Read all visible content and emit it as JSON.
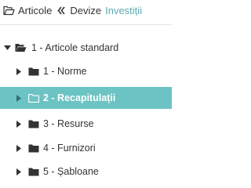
{
  "header": {
    "articole_label": "Articole",
    "devize_label": "Devize",
    "investitii_label": "Investiții",
    "collapse_glyph": "«"
  },
  "tree": {
    "root": {
      "label": "1 - Articole standard",
      "expanded": true
    },
    "children": [
      {
        "label": "1 - Norme",
        "selected": false
      },
      {
        "label": "2 - Recapitulații",
        "selected": true
      },
      {
        "label": "3 - Resurse",
        "selected": false
      },
      {
        "label": "4 - Furnizori",
        "selected": false
      },
      {
        "label": "5 - Șabloane",
        "selected": false
      }
    ]
  },
  "colors": {
    "selected_bg": "#6cc3c3",
    "accent_text": "#5aaab3",
    "folder_dark": "#333333"
  }
}
